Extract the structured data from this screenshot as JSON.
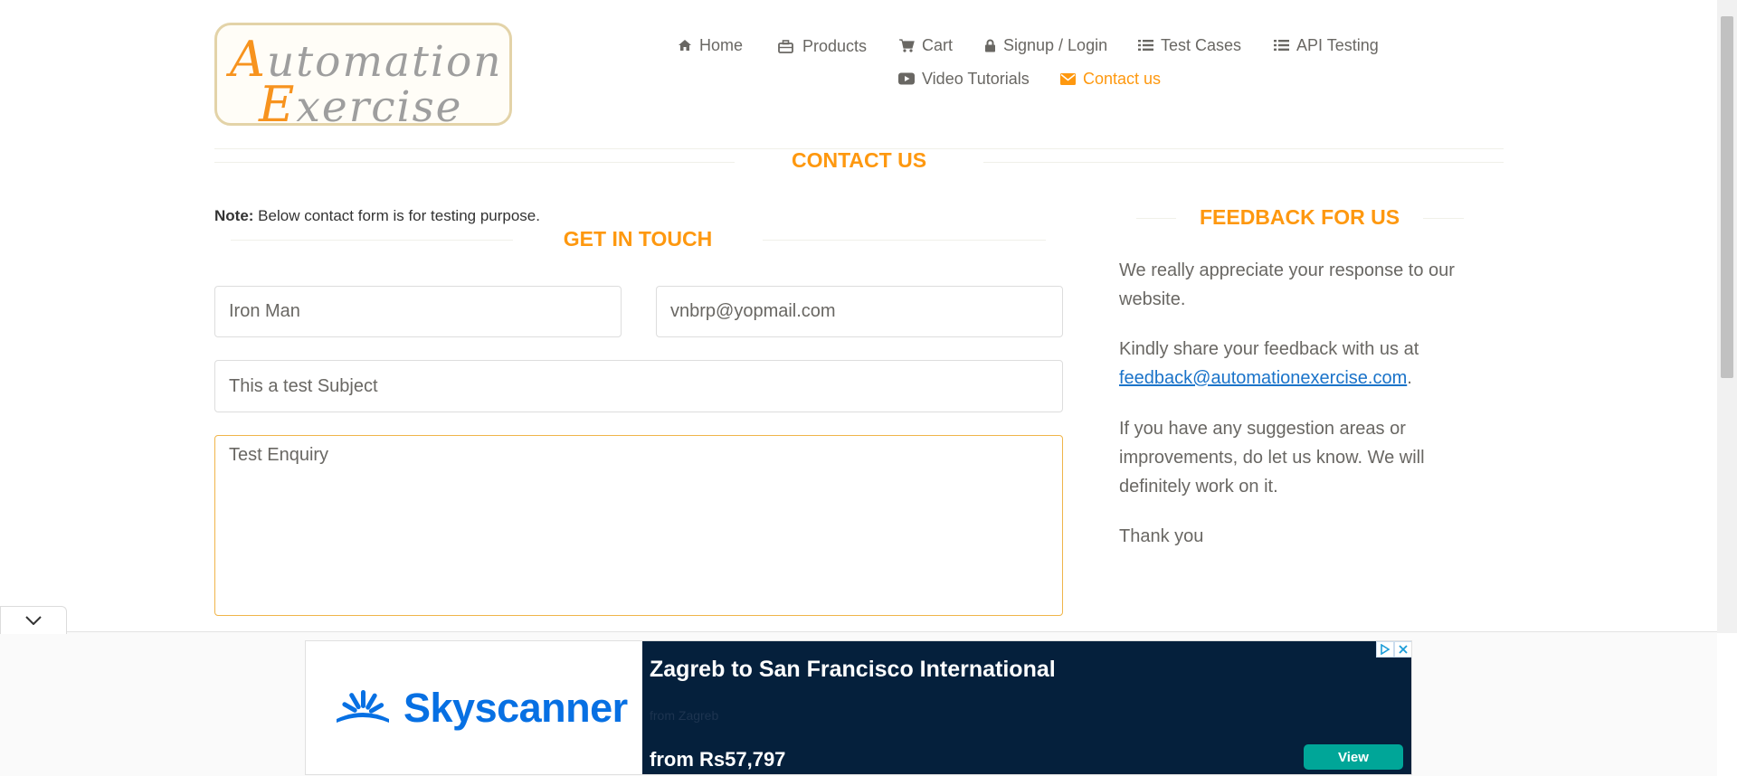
{
  "logo": {
    "line1_cap": "A",
    "line1_rest": "utomation",
    "line2_cap": "E",
    "line2_rest": "xercise"
  },
  "nav": {
    "items": [
      {
        "label": "Home",
        "icon": "home-icon"
      },
      {
        "label": "Products",
        "icon": "briefcase-icon"
      },
      {
        "label": "Cart",
        "icon": "cart-icon"
      },
      {
        "label": "Signup / Login",
        "icon": "lock-icon"
      },
      {
        "label": "Test Cases",
        "icon": "list-icon"
      },
      {
        "label": "API Testing",
        "icon": "list-icon"
      },
      {
        "label": "Video Tutorials",
        "icon": "youtube-icon"
      },
      {
        "label": "Contact us",
        "icon": "envelope-icon",
        "active": true
      }
    ]
  },
  "page": {
    "title": "CONTACT US"
  },
  "form": {
    "note_bold": "Note:",
    "note_text": " Below contact form is for testing purpose.",
    "title": "GET IN TOUCH",
    "name_value": "Iron Man",
    "email_value": "vnbrp@yopmail.com",
    "subject_value": "This a test Subject",
    "message_value": "Test Enquiry"
  },
  "feedback": {
    "title": "FEEDBACK FOR US",
    "p1": "We really appreciate your response to our website.",
    "p2_text": "Kindly share your feedback with us at ",
    "p2_link": "feedback@automationexercise.com",
    "p2_end": ".",
    "p3": "If you have any suggestion areas or improvements, do let us know. We will definitely work on it.",
    "p4": "Thank you"
  },
  "ad": {
    "brand": "Skyscanner",
    "headline": "Zagreb to San Francisco International",
    "from_text": "from Zagreb",
    "price": "from Rs57,797",
    "cta": "View"
  },
  "colors": {
    "accent": "#fe980f",
    "text": "#696763",
    "link": "#1a73c9",
    "ad_bg": "#05203c",
    "ad_cta": "#00a698"
  }
}
